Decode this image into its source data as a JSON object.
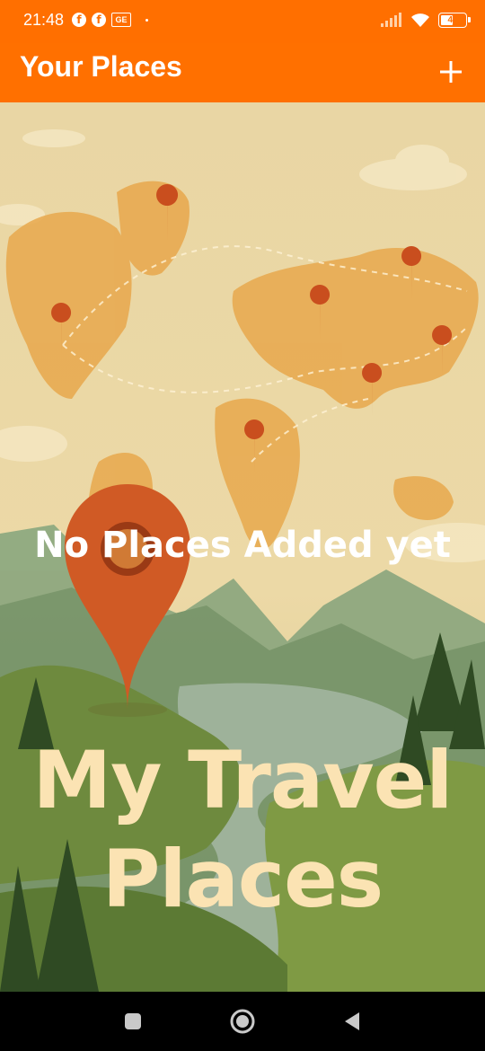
{
  "status_bar": {
    "time": "21:48",
    "notification_icons": [
      "facebook-icon",
      "facebook-icon",
      "news-icon"
    ],
    "battery_level": "47",
    "colors": {
      "background": "#ff6f00"
    }
  },
  "app_bar": {
    "title": "Your Places",
    "add_button_icon": "plus-icon",
    "colors": {
      "background": "#ff7000",
      "text": "#ffffff"
    }
  },
  "main": {
    "empty_message": "No Places Added yet",
    "hero_lines": [
      "My Travel",
      "Places"
    ]
  },
  "nav_bar": {
    "buttons": [
      "recent-apps-icon",
      "home-icon",
      "back-icon"
    ]
  }
}
